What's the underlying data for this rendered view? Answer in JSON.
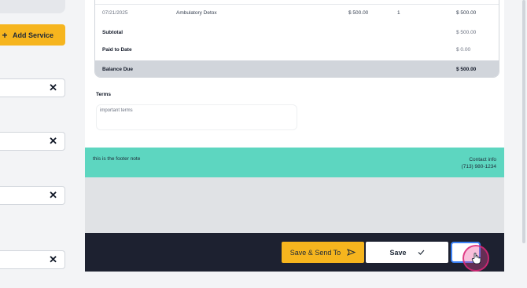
{
  "sidebar": {
    "add_service_label": "Add Service",
    "plus_glyph": "+",
    "remove_glyph": "✕"
  },
  "table": {
    "item": {
      "date": "07/21/2025",
      "description": "Ambulatory Detox",
      "rate": "$ 500.00",
      "qty": "1",
      "amount": "$ 500.00"
    },
    "subtotal": {
      "label": "Subtotal",
      "value": "$ 500.00"
    },
    "paid": {
      "label": "Paid to Date",
      "value": "$ 0.00"
    },
    "balance": {
      "label": "Balance Due",
      "value": "$ 500.00"
    }
  },
  "terms": {
    "label": "Terms",
    "placeholder": "important terms"
  },
  "footer": {
    "note": "this is the footer note",
    "contact_label": "Contact info",
    "contact_phone": "(713) 980-1234",
    "color": "#5dd6c0"
  },
  "actions": {
    "send_label": "Save & Send To",
    "save_label": "Save",
    "accent": "#f6b51e",
    "bar_color": "#1d2130"
  }
}
